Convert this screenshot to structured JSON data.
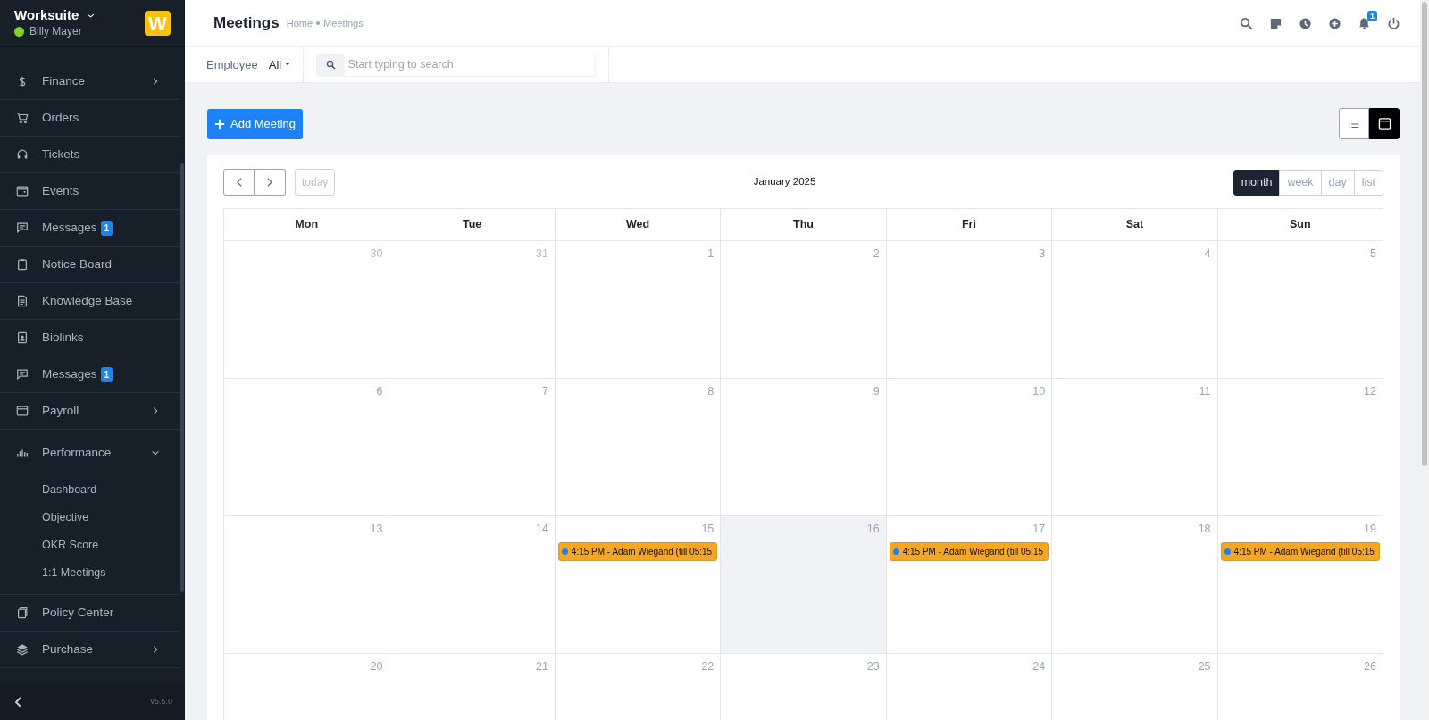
{
  "sidebar": {
    "brand": "Worksuite",
    "user": "Billy Mayer",
    "online": true,
    "logo_letter": "W",
    "items": [
      {
        "label": "Finance",
        "expanded": false
      },
      {
        "label": "Orders"
      },
      {
        "label": "Tickets"
      },
      {
        "label": "Events"
      },
      {
        "label": "Messages",
        "badge": "1"
      },
      {
        "label": "Notice Board"
      },
      {
        "label": "Knowledge Base"
      },
      {
        "label": "Biolinks"
      },
      {
        "label": "Messages",
        "badge": "1"
      },
      {
        "label": "Payroll",
        "expanded": false
      },
      {
        "label": "Performance",
        "expanded": true,
        "children": [
          {
            "label": "Dashboard"
          },
          {
            "label": "Objective"
          },
          {
            "label": "OKR Score"
          },
          {
            "label": "1:1 Meetings"
          }
        ]
      },
      {
        "label": "Policy Center"
      },
      {
        "label": "Purchase",
        "expanded": false
      }
    ],
    "version": "v5.5.0"
  },
  "header": {
    "title": "Meetings",
    "breadcrumb": [
      "Home",
      "Meetings"
    ],
    "notification_count": "1"
  },
  "filters": {
    "employee_label": "Employee",
    "employee_value": "All",
    "search": {
      "placeholder": "Start typing to search"
    }
  },
  "add_button": "Add Meeting",
  "layout_toggle": [
    {
      "kind": "list",
      "selected": false
    },
    {
      "kind": "calendar",
      "selected": true
    }
  ],
  "calendar": {
    "title": "January 2025",
    "today_button": "today",
    "views": [
      {
        "label": "month",
        "selected": true
      },
      {
        "label": "week",
        "selected": false
      },
      {
        "label": "day",
        "selected": false
      },
      {
        "label": "list",
        "selected": false
      }
    ],
    "weekdays": [
      "Mon",
      "Tue",
      "Wed",
      "Thu",
      "Fri",
      "Sat",
      "Sun"
    ],
    "weeks": [
      [
        {
          "day": "30",
          "other_month": true
        },
        {
          "day": "31",
          "other_month": true
        },
        {
          "day": "1"
        },
        {
          "day": "2"
        },
        {
          "day": "3"
        },
        {
          "day": "4"
        },
        {
          "day": "5"
        }
      ],
      [
        {
          "day": "6"
        },
        {
          "day": "7"
        },
        {
          "day": "8"
        },
        {
          "day": "9"
        },
        {
          "day": "10"
        },
        {
          "day": "11"
        },
        {
          "day": "12"
        }
      ],
      [
        {
          "day": "13"
        },
        {
          "day": "14"
        },
        {
          "day": "15",
          "events": [
            "4:15 PM - Adam Wiegand (till 05:15"
          ]
        },
        {
          "day": "16",
          "today": true
        },
        {
          "day": "17",
          "events": [
            "4:15 PM - Adam Wiegand (till 05:15"
          ]
        },
        {
          "day": "18"
        },
        {
          "day": "19",
          "events": [
            "4:15 PM - Adam Wiegand (till 05:15"
          ]
        }
      ],
      [
        {
          "day": "20"
        },
        {
          "day": "21"
        },
        {
          "day": "22"
        },
        {
          "day": "23"
        },
        {
          "day": "24"
        },
        {
          "day": "25"
        },
        {
          "day": "26"
        }
      ]
    ]
  }
}
